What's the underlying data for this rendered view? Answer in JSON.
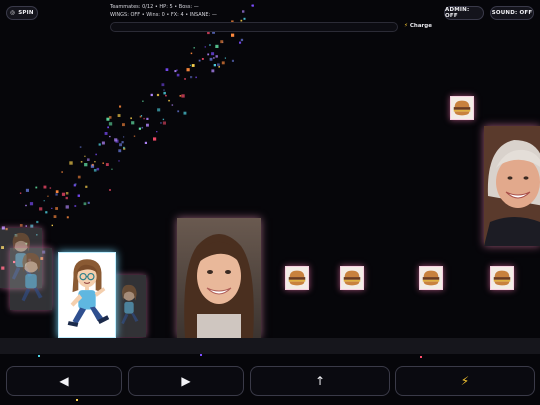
{
  "hud": {
    "spin_icon": "◎",
    "spin_label": "SPIN",
    "admin_label": "ADMIN: OFF",
    "sound_label": "SOUND: OFF"
  },
  "stats": {
    "line1": "Teammates: 0/12 • HP: 5 • Boss: —",
    "line2": "WINGS: OFF • Wins: 0 • FX: 4 • INSANE: —"
  },
  "charge": {
    "icon": "⚡",
    "label": "Charge",
    "level": 0,
    "fill_color": "#f4c430"
  },
  "controls": {
    "left_label": "◀",
    "right_label": "▶",
    "jump_label": "↑",
    "power_label": "⚡"
  },
  "icons": {
    "spin": "target-icon",
    "jump": "jump-arrow-icon",
    "power": "lightning-icon",
    "left": "left-arrow-icon",
    "right": "right-arrow-icon"
  }
}
